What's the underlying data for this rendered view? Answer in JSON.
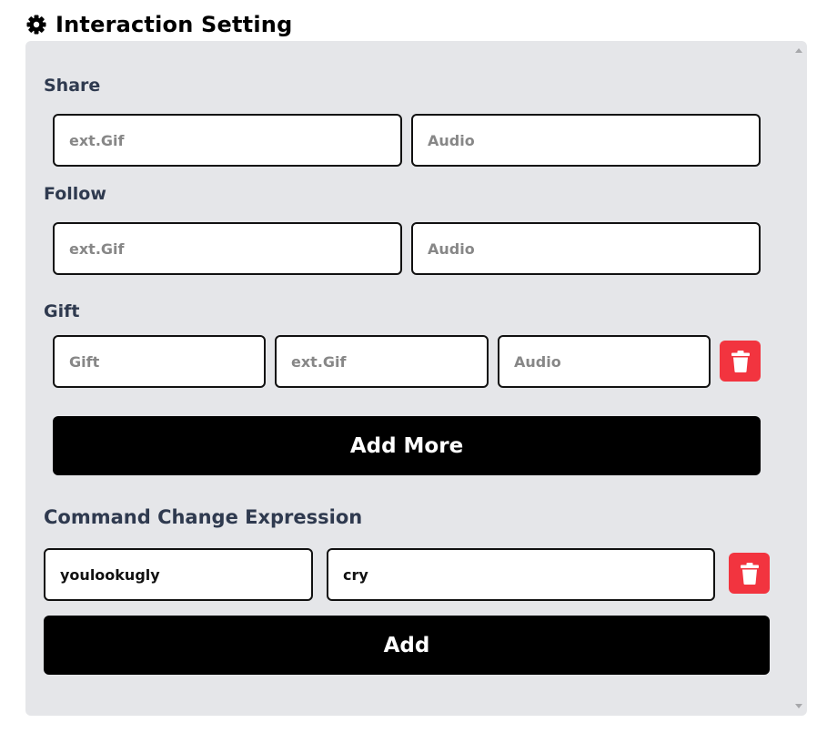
{
  "header": {
    "title": "Interaction Setting",
    "icon": "gear-icon"
  },
  "share": {
    "label": "Share",
    "gif_placeholder": "ext.Gif",
    "audio_placeholder": "Audio"
  },
  "follow": {
    "label": "Follow",
    "gif_placeholder": "ext.Gif",
    "audio_placeholder": "Audio"
  },
  "gift": {
    "label": "Gift",
    "rows": [
      {
        "gift_placeholder": "Gift",
        "gif_placeholder": "ext.Gif",
        "audio_placeholder": "Audio"
      }
    ],
    "add_more_label": "Add More"
  },
  "command": {
    "label": "Command Change Expression",
    "rows": [
      {
        "command_value": "youlookugly",
        "expression_value": "cry"
      }
    ],
    "add_label": "Add"
  },
  "colors": {
    "panel_bg": "#e5e6e9",
    "label_text": "#2f3a4f",
    "delete_button": "#f2343f",
    "primary_button": "#000000"
  }
}
